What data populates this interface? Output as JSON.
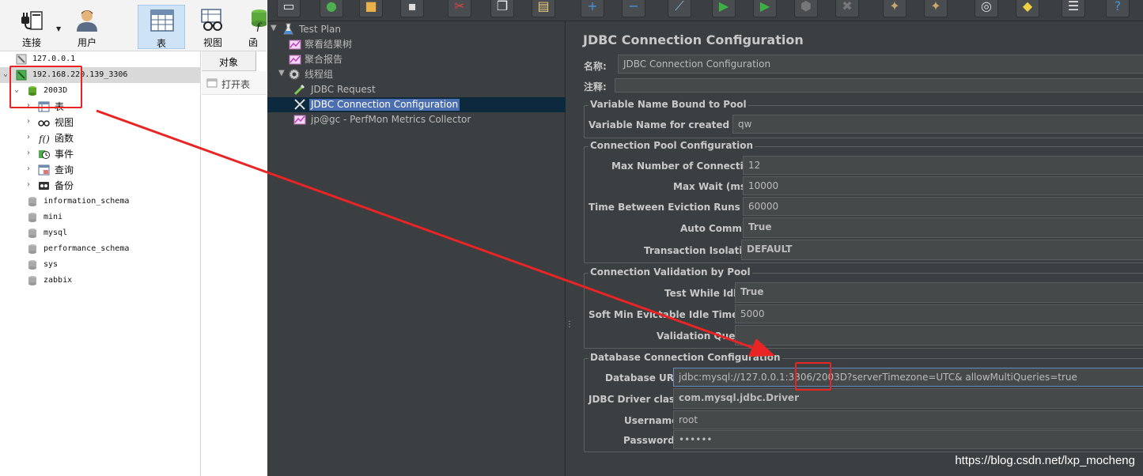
{
  "navicat": {
    "toolbar": {
      "connect_label": "连接",
      "user_label": "用户",
      "table_label": "表",
      "view_label": "视图",
      "function_label": "函"
    },
    "tree": {
      "connections": [
        {
          "label": "127.0.0.1"
        },
        {
          "label": "192.168.220.139_3306"
        }
      ],
      "selected_db": "2003D",
      "db_children": [
        {
          "label": "表",
          "icon": "table-icon"
        },
        {
          "label": "视图",
          "icon": "view-icon"
        },
        {
          "label": "函数",
          "icon": "function-icon"
        },
        {
          "label": "事件",
          "icon": "event-icon"
        },
        {
          "label": "查询",
          "icon": "query-icon"
        },
        {
          "label": "备份",
          "icon": "backup-icon"
        }
      ],
      "other_dbs": [
        "information_schema",
        "mini",
        "mysql",
        "performance_schema",
        "sys",
        "zabbix"
      ]
    },
    "objects": {
      "tab_label": "对象",
      "open_table_label": "打开表"
    }
  },
  "jmeter": {
    "tree": {
      "test_plan": "Test Plan",
      "view_results_tree": "察看结果树",
      "aggregate_report": "聚合报告",
      "thread_group": "线程组",
      "jdbc_request": "JDBC Request",
      "jdbc_connection_config": "JDBC Connection Configuration",
      "perfmon": "jp@gc - PerfMon Metrics Collector"
    },
    "form": {
      "title": "JDBC Connection Configuration",
      "name_label": "名称:",
      "name_value": "JDBC Connection Configuration",
      "comments_label": "注释:",
      "comments_value": "",
      "variable_group": {
        "title": "Variable Name Bound to Pool",
        "var_label": "Variable Name for created pool:",
        "var_value": "qw"
      },
      "pool_group": {
        "title": "Connection Pool Configuration",
        "max_conn_label": "Max Number of Connections:",
        "max_conn_value": "12",
        "max_wait_label": "Max Wait (ms):",
        "max_wait_value": "10000",
        "eviction_label": "Time Between Eviction Runs (ms):",
        "eviction_value": "60000",
        "autocommit_label": "Auto Commit:",
        "autocommit_value": "True",
        "isolation_label": "Transaction Isolation:",
        "isolation_value": "DEFAULT"
      },
      "validation_group": {
        "title": "Connection Validation by Pool",
        "idle_label": "Test While Idle:",
        "idle_value": "True",
        "soft_min_label": "Soft Min Evictable Idle Time(ms):",
        "soft_min_value": "5000",
        "query_label": "Validation Query:",
        "query_value": ""
      },
      "db_group": {
        "title": "Database Connection Configuration",
        "url_label": "Database URL:",
        "url_value": "jdbc:mysql://127.0.0.1:3306/2003D?serverTimezone=UTC& allowMultiQueries=true",
        "driver_label": "JDBC Driver class:",
        "driver_value": "com.mysql.jdbc.Driver",
        "user_label": "Username:",
        "user_value": "root",
        "password_label": "Password:",
        "password_value": "••••••"
      }
    }
  },
  "watermark": "https://blog.csdn.net/lxp_mocheng",
  "colors": {
    "jmeter_bg": "#3c3f41",
    "highlight": "#e82424",
    "selection": "#4b6eaf"
  }
}
